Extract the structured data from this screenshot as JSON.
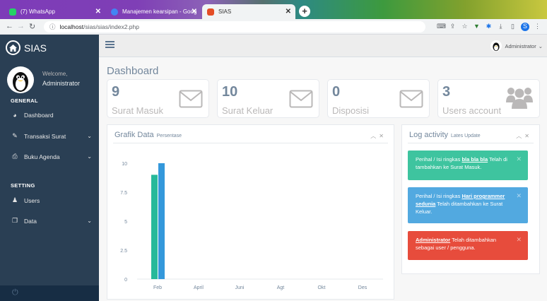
{
  "browser": {
    "tabs": [
      {
        "label": "(7) WhatsApp",
        "color": "#25d366",
        "active": false
      },
      {
        "label": "Manajemen kearsipan - Google",
        "color": "#4285f4",
        "active": false
      },
      {
        "label": "SIAS",
        "color": "#e44d26",
        "active": true
      }
    ],
    "url_host": "localhost",
    "url_path": "/sias/sias/index2.php",
    "profile_letter": "S"
  },
  "sidebar": {
    "brand": "SIAS",
    "welcome": "Welcome,",
    "user": "Administrator",
    "section_general": "GENERAL",
    "section_setting": "SETTING",
    "items": [
      {
        "label": "Dashboard",
        "icon": "dashboard-icon",
        "chevron": false
      },
      {
        "label": "Transaksi Surat",
        "icon": "edit-icon",
        "chevron": true
      },
      {
        "label": "Buku Agenda",
        "icon": "print-icon",
        "chevron": true
      },
      {
        "label": "Users",
        "icon": "user-icon",
        "chevron": false
      },
      {
        "label": "Data",
        "icon": "copy-icon",
        "chevron": true
      }
    ]
  },
  "topnav": {
    "user": "Administrator"
  },
  "page": {
    "title": "Dashboard"
  },
  "tiles": [
    {
      "count": "9",
      "label": "Surat Masuk",
      "icon": "envelope-icon"
    },
    {
      "count": "10",
      "label": "Surat Keluar",
      "icon": "envelope-icon"
    },
    {
      "count": "0",
      "label": "Disposisi",
      "icon": "envelope-icon"
    },
    {
      "count": "3",
      "label": "Users account",
      "icon": "users-icon"
    }
  ],
  "grafik": {
    "title": "Grafik Data",
    "subtitle": "Persentase"
  },
  "chart_data": {
    "type": "bar",
    "categories": [
      "Feb",
      "April",
      "Juni",
      "Agt",
      "Okt",
      "Des"
    ],
    "series": [
      {
        "color": "#26b99a",
        "values": [
          9,
          0,
          0,
          0,
          0,
          0
        ]
      },
      {
        "color": "#3498db",
        "values": [
          10,
          0,
          0,
          0,
          0,
          0
        ]
      }
    ],
    "yticks": [
      "0",
      "2.5",
      "5",
      "7.5",
      "10"
    ],
    "ylim": [
      0,
      10
    ],
    "grid": false
  },
  "log": {
    "title": "Log activity",
    "subtitle": "Lates Update",
    "entries": [
      {
        "color": "#3ec49f",
        "pre": "Perihal / Isi ringkas ",
        "link": "bla bla bla",
        "post": " Telah di tambahkan ke Surat Masuk."
      },
      {
        "color": "#52a9e0",
        "pre": "Perihal / Isi ringkas ",
        "link": "Hari programmer sedunia",
        "post": " Telah ditambahkan ke Surat Keluar."
      },
      {
        "color": "#e74c3c",
        "pre": "",
        "link": "Administrator",
        "post": " Telah ditambahkan sebagai user / pengguna."
      }
    ]
  }
}
